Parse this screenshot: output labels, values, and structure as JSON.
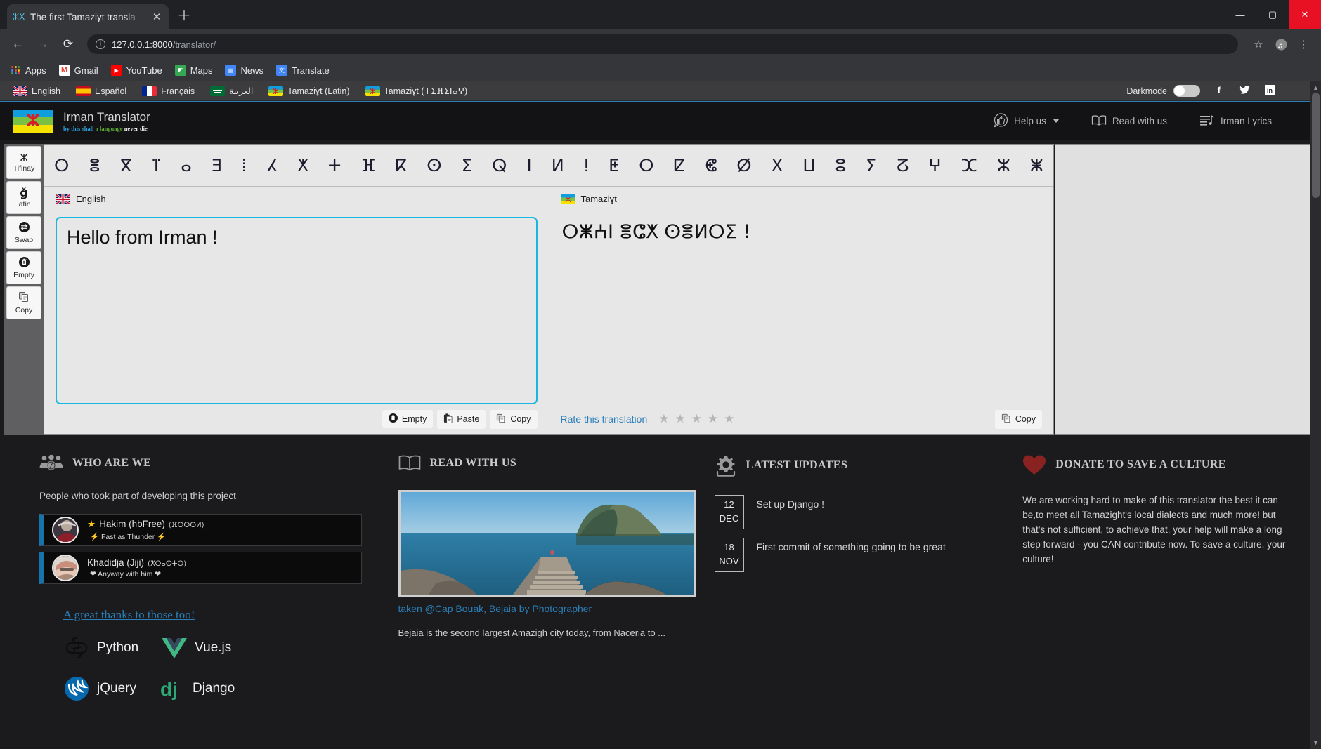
{
  "browser": {
    "tab": {
      "title": "The first Tamaziɣt transla",
      "favicon_icon": "tifinagh-favicon",
      "close_icon": "close-icon"
    },
    "new_tab_icon": "plus-icon",
    "window_controls": {
      "minimize": "minimize-icon",
      "maximize": "maximize-icon",
      "close": "close-icon"
    },
    "nav": {
      "back_icon": "back-arrow-icon",
      "forward_icon": "forward-arrow-icon",
      "reload_icon": "reload-icon"
    },
    "omnibox": {
      "info_icon": "info-circle-icon",
      "host": "127.0.0.1:8000",
      "path": "/translator/"
    },
    "toolbar_right": [
      {
        "name": "bookmark-star-icon",
        "glyph": "☆"
      },
      {
        "name": "profile-avatar-icon",
        "glyph": "♬"
      },
      {
        "name": "chrome-menu-icon",
        "glyph": "⋮"
      }
    ],
    "bookmarks": [
      {
        "label": "Apps",
        "icon": "apps-grid-icon"
      },
      {
        "label": "Gmail",
        "icon": "gmail-icon"
      },
      {
        "label": "YouTube",
        "icon": "youtube-icon"
      },
      {
        "label": "Maps",
        "icon": "maps-icon"
      },
      {
        "label": "News",
        "icon": "news-icon"
      },
      {
        "label": "Translate",
        "icon": "translate-icon"
      }
    ]
  },
  "langbar": {
    "languages": [
      {
        "label": "English",
        "flag": "uk-flag"
      },
      {
        "label": "Español",
        "flag": "spain-flag"
      },
      {
        "label": "Français",
        "flag": "france-flag"
      },
      {
        "label": "العربية",
        "flag": "saudi-flag"
      },
      {
        "label": "Tamaziɣt (Latin)",
        "flag": "amazigh-flag"
      },
      {
        "label": "Tamaziɣt (ⵜⵉⴼⵉⵏⴰⵖ)",
        "flag": "amazigh-flag"
      }
    ],
    "darkmode_label": "Darkmode",
    "darkmode_on": false,
    "socials": [
      {
        "name": "facebook-icon",
        "glyph": "f"
      },
      {
        "name": "twitter-icon",
        "glyph": "🐦"
      },
      {
        "name": "linkedin-icon",
        "glyph": "in"
      }
    ]
  },
  "header": {
    "logo_icon": "amazigh-flag-logo",
    "logo_yaz": "ⵣ",
    "title": "Irman Translator",
    "tagline_1": "by this shall",
    "tagline_2": "a language",
    "tagline_3": "never die",
    "nav": [
      {
        "label": "Help us",
        "icon": "thumbs-up-icon",
        "has_caret": true
      },
      {
        "label": "Read with us",
        "icon": "open-book-icon",
        "has_caret": false
      },
      {
        "label": "Irman Lyrics",
        "icon": "lyrics-lines-icon",
        "has_caret": false
      }
    ]
  },
  "translator": {
    "sidebar": [
      {
        "label": "Tifinay",
        "icon": "tifinagh-yaz-icon",
        "glyph": "ⵣ"
      },
      {
        "label": "latin",
        "icon": "latin-g-icon",
        "glyph": "ǧ"
      },
      {
        "label": "Swap",
        "icon": "swap-arrows-icon",
        "glyph": "⇄"
      },
      {
        "label": "Empty",
        "icon": "trash-icon",
        "glyph": "🗑"
      },
      {
        "label": "Copy",
        "icon": "copy-icon",
        "glyph": "⧉"
      }
    ],
    "charbar": [
      "ⵔ",
      "ⴻ",
      "ⴳ",
      "ⴶ",
      "ⴰ",
      "ⴺ",
      "ⵂ",
      "ⵃ",
      "ⵅ",
      "ⵜ",
      "ⴼ",
      "ⴽ",
      "ⵙ",
      "ⵉ",
      "ⵕ",
      "ⵏ",
      "ⵍ",
      "ⵑ",
      "ⵟ",
      "ⵔ",
      "ⵇ",
      "ⵞ",
      "ⵁ",
      "ⵝ",
      "ⵡ",
      "ⵓ",
      "ⵢ",
      "ⵒ",
      "ⵖ",
      "ⵋ",
      "ⵣ",
      "ⵥ"
    ],
    "source": {
      "lang_label": "English",
      "flag": "uk-flag",
      "text": "Hello from Irman !",
      "buttons": [
        {
          "label": "Empty",
          "icon": "trash-icon",
          "glyph": "🗑"
        },
        {
          "label": "Paste",
          "icon": "paste-icon",
          "glyph": "📋"
        },
        {
          "label": "Copy",
          "icon": "copy-icon",
          "glyph": "⧉"
        }
      ]
    },
    "target": {
      "lang_label": "Tamaziɣt",
      "flag": "amazigh-flag",
      "text": "ⵔⵥⵄⵏ ⴻⵛⵅ ⵙⴻⵍⵔⵉ !",
      "rate_label": "Rate this translation",
      "stars": 5,
      "stars_filled": 0,
      "copy_button": {
        "label": "Copy",
        "icon": "copy-icon",
        "glyph": "⧉"
      }
    }
  },
  "footer": {
    "who": {
      "title": "WHO ARE WE",
      "icon": "people-group-icon",
      "subtitle": "People who took part of developing this project",
      "contributors": [
        {
          "name": "Hakim (hbFree)",
          "tifinagh": "(ⴼⵔⵔⵙⵍ)",
          "badge": "★",
          "motto": "⚡ Fast as Thunder ⚡",
          "avatar": "avatar-hakim"
        },
        {
          "name": "Khadidja (Jiji)",
          "tifinagh": "(ⵅⵔⴰⵙⵜⵔ)",
          "badge": "",
          "motto": "❤ Anyway with him ❤",
          "avatar": "avatar-khadidja"
        }
      ],
      "thanks_link": "A great thanks to those too!",
      "tech": [
        {
          "label": "Python",
          "icon": "python-icon"
        },
        {
          "label": "Vue.js",
          "icon": "vuejs-icon"
        },
        {
          "label": "jQuery",
          "icon": "jquery-icon"
        },
        {
          "label": "Django",
          "icon": "django-icon"
        }
      ]
    },
    "read": {
      "title": "READ WITH US",
      "icon": "open-book-icon",
      "photo_alt": "coastal-cliff-photo",
      "caption": "taken @Cap Bouak, Bejaia by Photographer",
      "description": "Bejaia is the second largest Amazigh city today, from Naceria to ..."
    },
    "updates": {
      "title": "LATEST UPDATES",
      "icon": "gear-icon",
      "items": [
        {
          "day": "12",
          "month": "DEC",
          "text": "Set up Django !"
        },
        {
          "day": "18",
          "month": "NOV",
          "text": "First commit of something going to be great"
        }
      ]
    },
    "donate": {
      "title": "DONATE TO SAVE A CULTURE",
      "icon": "heart-icon",
      "body": "We are working hard to make of this translator the best it can be,to meet all Tamazight's local dialects and much more! but that's not sufficient, to achieve that, your help will make a long step forward - you CAN contribute now. To save a culture, your culture!"
    }
  },
  "colors": {
    "accent_blue": "#2b7fb8",
    "cyan_border": "#19b6e0",
    "page_bg": "#1b1b1d",
    "panel_bg": "#e7e7e7",
    "heart_red": "#8b2222"
  }
}
